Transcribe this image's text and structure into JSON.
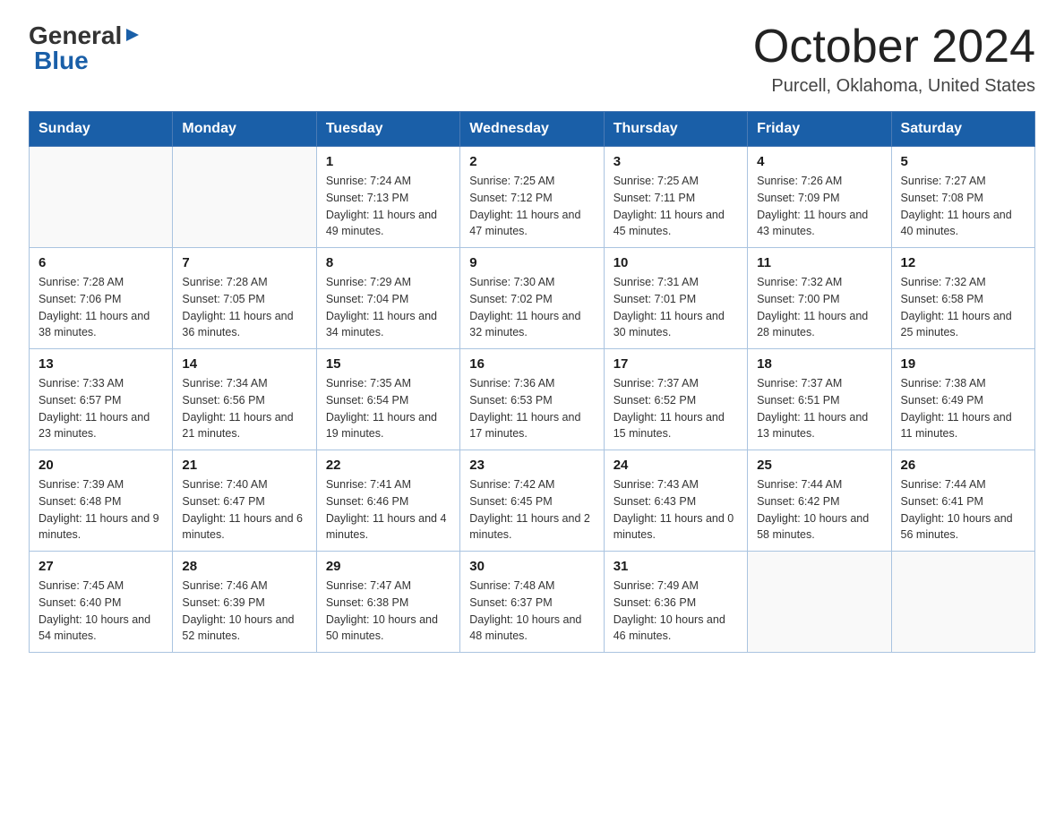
{
  "header": {
    "logo_general": "General",
    "logo_blue": "Blue",
    "title": "October 2024",
    "location": "Purcell, Oklahoma, United States"
  },
  "weekdays": [
    "Sunday",
    "Monday",
    "Tuesday",
    "Wednesday",
    "Thursday",
    "Friday",
    "Saturday"
  ],
  "weeks": [
    [
      {
        "day": "",
        "sunrise": "",
        "sunset": "",
        "daylight": ""
      },
      {
        "day": "",
        "sunrise": "",
        "sunset": "",
        "daylight": ""
      },
      {
        "day": "1",
        "sunrise": "Sunrise: 7:24 AM",
        "sunset": "Sunset: 7:13 PM",
        "daylight": "Daylight: 11 hours and 49 minutes."
      },
      {
        "day": "2",
        "sunrise": "Sunrise: 7:25 AM",
        "sunset": "Sunset: 7:12 PM",
        "daylight": "Daylight: 11 hours and 47 minutes."
      },
      {
        "day": "3",
        "sunrise": "Sunrise: 7:25 AM",
        "sunset": "Sunset: 7:11 PM",
        "daylight": "Daylight: 11 hours and 45 minutes."
      },
      {
        "day": "4",
        "sunrise": "Sunrise: 7:26 AM",
        "sunset": "Sunset: 7:09 PM",
        "daylight": "Daylight: 11 hours and 43 minutes."
      },
      {
        "day": "5",
        "sunrise": "Sunrise: 7:27 AM",
        "sunset": "Sunset: 7:08 PM",
        "daylight": "Daylight: 11 hours and 40 minutes."
      }
    ],
    [
      {
        "day": "6",
        "sunrise": "Sunrise: 7:28 AM",
        "sunset": "Sunset: 7:06 PM",
        "daylight": "Daylight: 11 hours and 38 minutes."
      },
      {
        "day": "7",
        "sunrise": "Sunrise: 7:28 AM",
        "sunset": "Sunset: 7:05 PM",
        "daylight": "Daylight: 11 hours and 36 minutes."
      },
      {
        "day": "8",
        "sunrise": "Sunrise: 7:29 AM",
        "sunset": "Sunset: 7:04 PM",
        "daylight": "Daylight: 11 hours and 34 minutes."
      },
      {
        "day": "9",
        "sunrise": "Sunrise: 7:30 AM",
        "sunset": "Sunset: 7:02 PM",
        "daylight": "Daylight: 11 hours and 32 minutes."
      },
      {
        "day": "10",
        "sunrise": "Sunrise: 7:31 AM",
        "sunset": "Sunset: 7:01 PM",
        "daylight": "Daylight: 11 hours and 30 minutes."
      },
      {
        "day": "11",
        "sunrise": "Sunrise: 7:32 AM",
        "sunset": "Sunset: 7:00 PM",
        "daylight": "Daylight: 11 hours and 28 minutes."
      },
      {
        "day": "12",
        "sunrise": "Sunrise: 7:32 AM",
        "sunset": "Sunset: 6:58 PM",
        "daylight": "Daylight: 11 hours and 25 minutes."
      }
    ],
    [
      {
        "day": "13",
        "sunrise": "Sunrise: 7:33 AM",
        "sunset": "Sunset: 6:57 PM",
        "daylight": "Daylight: 11 hours and 23 minutes."
      },
      {
        "day": "14",
        "sunrise": "Sunrise: 7:34 AM",
        "sunset": "Sunset: 6:56 PM",
        "daylight": "Daylight: 11 hours and 21 minutes."
      },
      {
        "day": "15",
        "sunrise": "Sunrise: 7:35 AM",
        "sunset": "Sunset: 6:54 PM",
        "daylight": "Daylight: 11 hours and 19 minutes."
      },
      {
        "day": "16",
        "sunrise": "Sunrise: 7:36 AM",
        "sunset": "Sunset: 6:53 PM",
        "daylight": "Daylight: 11 hours and 17 minutes."
      },
      {
        "day": "17",
        "sunrise": "Sunrise: 7:37 AM",
        "sunset": "Sunset: 6:52 PM",
        "daylight": "Daylight: 11 hours and 15 minutes."
      },
      {
        "day": "18",
        "sunrise": "Sunrise: 7:37 AM",
        "sunset": "Sunset: 6:51 PM",
        "daylight": "Daylight: 11 hours and 13 minutes."
      },
      {
        "day": "19",
        "sunrise": "Sunrise: 7:38 AM",
        "sunset": "Sunset: 6:49 PM",
        "daylight": "Daylight: 11 hours and 11 minutes."
      }
    ],
    [
      {
        "day": "20",
        "sunrise": "Sunrise: 7:39 AM",
        "sunset": "Sunset: 6:48 PM",
        "daylight": "Daylight: 11 hours and 9 minutes."
      },
      {
        "day": "21",
        "sunrise": "Sunrise: 7:40 AM",
        "sunset": "Sunset: 6:47 PM",
        "daylight": "Daylight: 11 hours and 6 minutes."
      },
      {
        "day": "22",
        "sunrise": "Sunrise: 7:41 AM",
        "sunset": "Sunset: 6:46 PM",
        "daylight": "Daylight: 11 hours and 4 minutes."
      },
      {
        "day": "23",
        "sunrise": "Sunrise: 7:42 AM",
        "sunset": "Sunset: 6:45 PM",
        "daylight": "Daylight: 11 hours and 2 minutes."
      },
      {
        "day": "24",
        "sunrise": "Sunrise: 7:43 AM",
        "sunset": "Sunset: 6:43 PM",
        "daylight": "Daylight: 11 hours and 0 minutes."
      },
      {
        "day": "25",
        "sunrise": "Sunrise: 7:44 AM",
        "sunset": "Sunset: 6:42 PM",
        "daylight": "Daylight: 10 hours and 58 minutes."
      },
      {
        "day": "26",
        "sunrise": "Sunrise: 7:44 AM",
        "sunset": "Sunset: 6:41 PM",
        "daylight": "Daylight: 10 hours and 56 minutes."
      }
    ],
    [
      {
        "day": "27",
        "sunrise": "Sunrise: 7:45 AM",
        "sunset": "Sunset: 6:40 PM",
        "daylight": "Daylight: 10 hours and 54 minutes."
      },
      {
        "day": "28",
        "sunrise": "Sunrise: 7:46 AM",
        "sunset": "Sunset: 6:39 PM",
        "daylight": "Daylight: 10 hours and 52 minutes."
      },
      {
        "day": "29",
        "sunrise": "Sunrise: 7:47 AM",
        "sunset": "Sunset: 6:38 PM",
        "daylight": "Daylight: 10 hours and 50 minutes."
      },
      {
        "day": "30",
        "sunrise": "Sunrise: 7:48 AM",
        "sunset": "Sunset: 6:37 PM",
        "daylight": "Daylight: 10 hours and 48 minutes."
      },
      {
        "day": "31",
        "sunrise": "Sunrise: 7:49 AM",
        "sunset": "Sunset: 6:36 PM",
        "daylight": "Daylight: 10 hours and 46 minutes."
      },
      {
        "day": "",
        "sunrise": "",
        "sunset": "",
        "daylight": ""
      },
      {
        "day": "",
        "sunrise": "",
        "sunset": "",
        "daylight": ""
      }
    ]
  ]
}
